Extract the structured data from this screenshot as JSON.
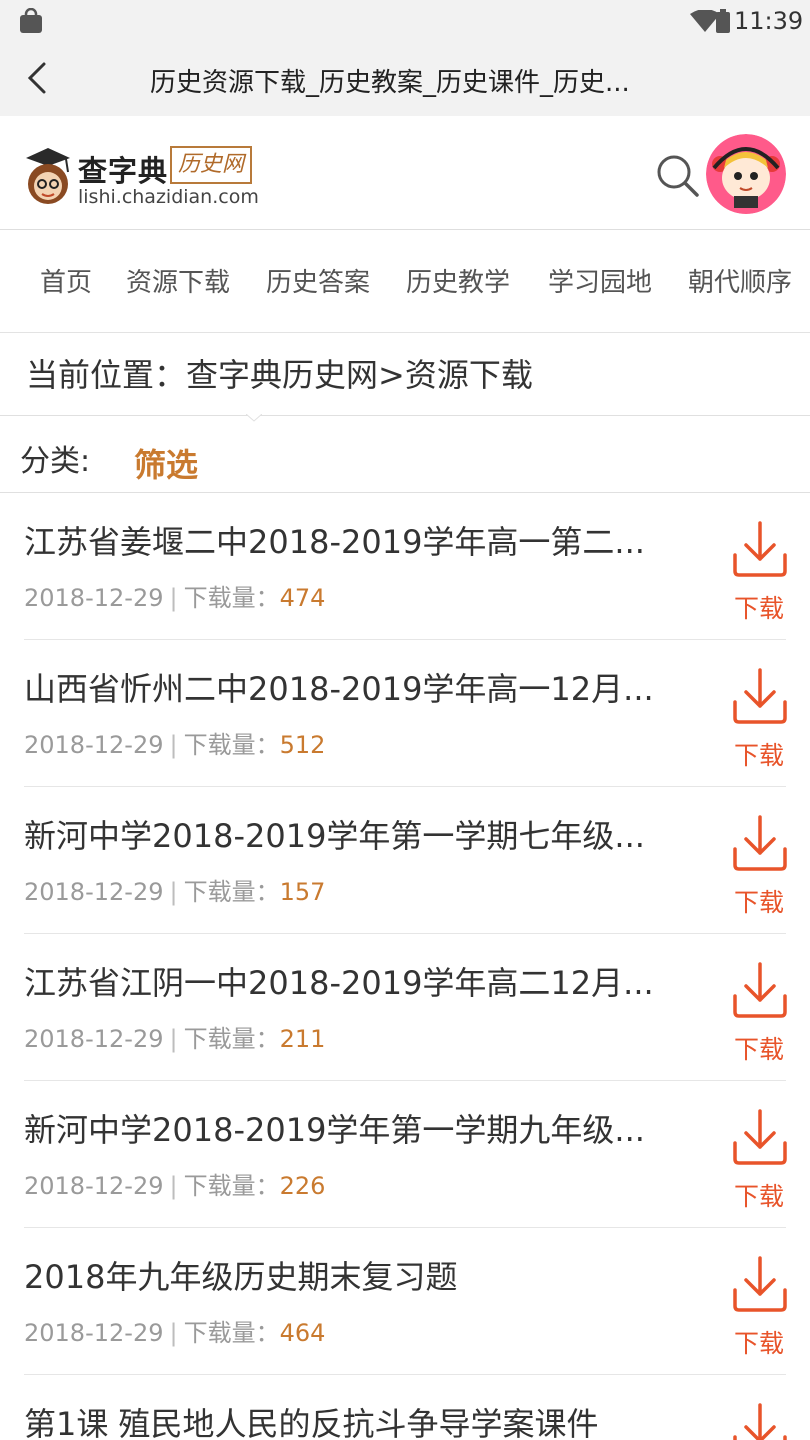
{
  "status_bar": {
    "time": "11:39"
  },
  "title_bar": {
    "title": "历史资源下载_历史教案_历史课件_历史..."
  },
  "header": {
    "brand": "查字典",
    "stamp": "历史网",
    "domain": "lishi.chazidian.com"
  },
  "nav": {
    "items": [
      "首页",
      "资源下载",
      "历史答案",
      "历史教学",
      "学习园地",
      "朝代顺序"
    ]
  },
  "breadcrumb": "当前位置：查字典历史网>资源下载",
  "filter": {
    "label": "分类:",
    "value": "筛选"
  },
  "list": {
    "download_label": "下载",
    "count_prefix": "下载量：",
    "items": [
      {
        "title": "江苏省姜堰二中2018-2019学年高一第二...",
        "date": "2018-12-29",
        "count": "474"
      },
      {
        "title": "山西省忻州二中2018-2019学年高一12月...",
        "date": "2018-12-29",
        "count": "512"
      },
      {
        "title": "新河中学2018-2019学年第一学期七年级...",
        "date": "2018-12-29",
        "count": "157"
      },
      {
        "title": "江苏省江阴一中2018-2019学年高二12月...",
        "date": "2018-12-29",
        "count": "211"
      },
      {
        "title": "新河中学2018-2019学年第一学期九年级...",
        "date": "2018-12-29",
        "count": "226"
      },
      {
        "title": "2018年九年级历史期末复习题",
        "date": "2018-12-29",
        "count": "464"
      },
      {
        "title": "第1课 殖民地人民的反抗斗争导学案课件",
        "date": "",
        "count": ""
      }
    ]
  },
  "colors": {
    "accent": "#c97a2f",
    "download": "#e8542a"
  }
}
